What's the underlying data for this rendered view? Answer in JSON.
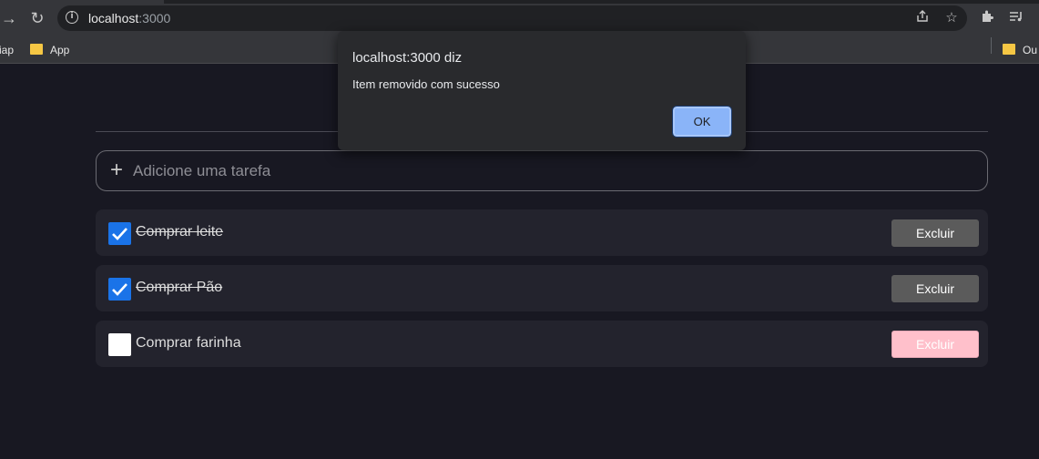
{
  "browser": {
    "url_host": "localhost",
    "url_port": ":3000",
    "bookmarks": [
      {
        "label": "iap"
      },
      {
        "label": "App"
      },
      {
        "label": "Ou"
      }
    ]
  },
  "page": {
    "add_task_placeholder": "Adicione uma tarefa",
    "tasks": [
      {
        "label": "Comprar leite",
        "done": true,
        "delete_label": "Excluir"
      },
      {
        "label": "Comprar Pão",
        "done": true,
        "delete_label": "Excluir"
      },
      {
        "label": "Comprar farinha",
        "done": false,
        "delete_label": "Excluir"
      }
    ]
  },
  "alert": {
    "title": "localhost:3000 diz",
    "message": "Item removido com sucesso",
    "ok_label": "OK"
  },
  "colors": {
    "checkbox_checked": "#1a73e8",
    "delete_button": "#5b5b5b",
    "delete_button_active": "#ffc0cb",
    "alert_ok": "#8ab4f8"
  }
}
